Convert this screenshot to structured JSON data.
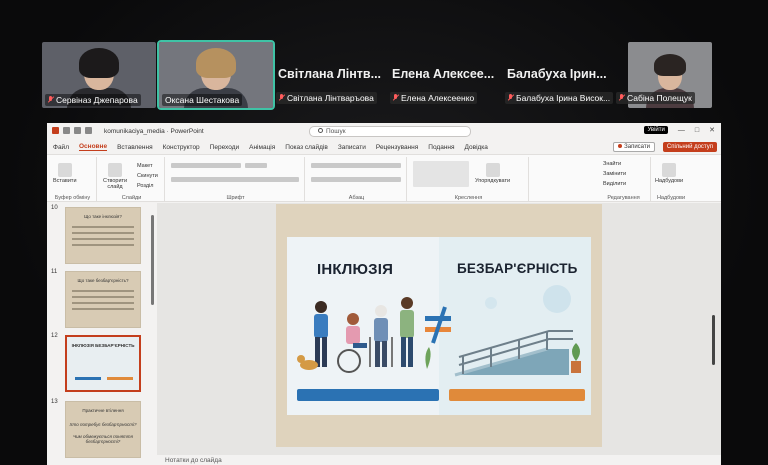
{
  "meeting": {
    "participants": [
      {
        "name": "Сервіназ Джепарова",
        "muted": true
      },
      {
        "name": "Оксана Шестакова",
        "muted": false,
        "active": true
      },
      {
        "name_large": "Світлана Лінтв...",
        "name": "Світлана Лінтваръова",
        "muted": true
      },
      {
        "name_large": "Елена Алексее...",
        "name": "Елена Алексеенко",
        "muted": true
      },
      {
        "name_large": "Балабуха Ірин...",
        "name": "Балабуха Ірина Висок...",
        "muted": true
      },
      {
        "name": "Сабіна Полещук",
        "muted": true
      }
    ]
  },
  "app": {
    "filename": "komunikaciya_media",
    "appname": "PowerPoint",
    "search_placeholder": "Пошук",
    "user_badge": "Увійти",
    "window_buttons": [
      "—",
      "□",
      "✕"
    ],
    "tabs": [
      "Файл",
      "Основне",
      "Вставлення",
      "Конструктор",
      "Переходи",
      "Анімація",
      "Показ слайдів",
      "Записати",
      "Рецензування",
      "Подання",
      "Довідка"
    ],
    "active_tab": "Основне",
    "record_button": "Записати",
    "share_button": "Спільний доступ"
  },
  "ribbon": {
    "groups": [
      "Буфер обміну",
      "Слайди",
      "Шрифт",
      "Абзац",
      "Креслення",
      "Редагування",
      "Надбудови"
    ],
    "paste_label": "Вставити",
    "new_slide_label": "Створити слайд",
    "layout_label": "Макет",
    "reset_label": "Скинути",
    "section_label": "Розділ",
    "arrange_label": "Упорядкувати",
    "find_label": "Знайти",
    "replace_label": "Замінити",
    "select_label": "Виділити",
    "addins_label": "Надбудови"
  },
  "thumbnails": [
    {
      "num": "10",
      "title": "Що таке інклюзія?"
    },
    {
      "num": "11",
      "title": "Що таке безбар'єрність?"
    },
    {
      "num": "12",
      "title": "ІНКЛЮЗІЯ   БЕЗБАР'ЄРНІСТЬ",
      "selected": true
    },
    {
      "num": "13",
      "title": "Практичне втілення",
      "line1": "Хто потребує безбар'єрності?",
      "line2": "Чим обмежується поняття безбар'єрності?"
    }
  ],
  "slide": {
    "left_word": "ІНКЛЮЗІЯ",
    "right_word": "БЕЗБАР'ЄРНІСТЬ",
    "symbol": "≠",
    "colors": {
      "left_bar": "#2b72b3",
      "right_bar": "#e08a3a",
      "symbol_blue": "#2b72b3",
      "symbol_orange": "#e8863a"
    }
  },
  "notes_placeholder": "Нотатки до слайда"
}
